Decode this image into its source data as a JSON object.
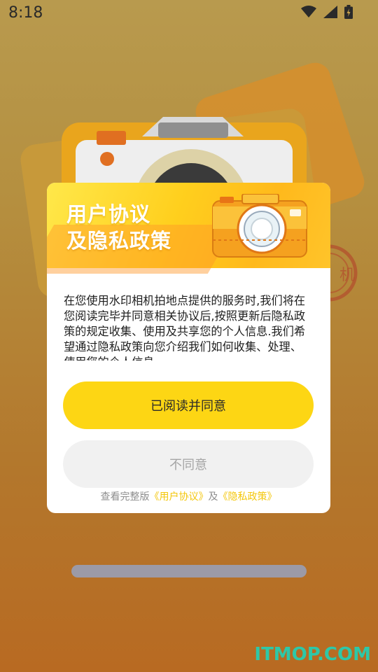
{
  "status_bar": {
    "time": "8:18"
  },
  "dialog": {
    "title_line1": "用户协议",
    "title_line2": "及隐私政策",
    "body_text": "在您使用水印相机拍地点提供的服务时,我们将在您阅读完毕并同意相关协议后,按照更新后隐私政策的规定收集、使用及共享您的个人信息.我们希望通过隐私政策向您介绍我们如何收集、处理、使用您的个人信息。",
    "agree_label": "已阅读并同意",
    "disagree_label": "不同意",
    "footer": {
      "prefix": "查看完整版",
      "user_agreement": "《用户协议》",
      "connector": "及",
      "privacy_policy": "《隐私政策》"
    }
  },
  "background": {
    "stamp_text": "机"
  },
  "watermark": "ITMOP.COM",
  "colors": {
    "accent": "#fdd614",
    "link": "#f4c70c",
    "disabled_bg": "#f1f1f1",
    "watermark": "#2ec8a8"
  },
  "icons": [
    "wifi-icon",
    "signal-icon",
    "battery-icon",
    "camera-illustration"
  ]
}
